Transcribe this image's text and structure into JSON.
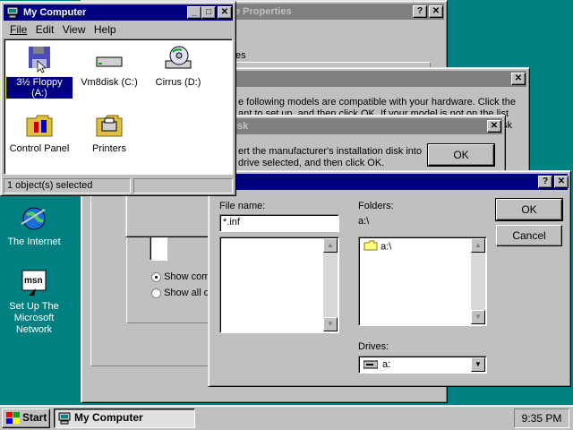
{
  "desktop": {
    "icons": [
      {
        "label": "The Internet",
        "icon": "internet-globe-icon"
      },
      {
        "label": "Set Up The Microsoft Network",
        "icon": "msn-icon"
      }
    ]
  },
  "my_computer": {
    "title": "My Computer",
    "menu": [
      "File",
      "Edit",
      "View",
      "Help"
    ],
    "items": [
      {
        "label": "3½ Floppy (A:)",
        "icon": "floppy-drive-icon",
        "selected": true
      },
      {
        "label": "Vm8disk (C:)",
        "icon": "hard-drive-icon"
      },
      {
        "label": "Cirrus (D:)",
        "icon": "cd-drive-icon"
      },
      {
        "label": "Control Panel",
        "icon": "control-panel-icon"
      },
      {
        "label": "Printers",
        "icon": "printers-folder-icon"
      }
    ],
    "status": "1 object(s) selected"
  },
  "properties": {
    "title_fragment": "e Properties",
    "tab_fragment": "es",
    "radio1": "Show com",
    "radio2": "Show all d"
  },
  "models": {
    "text_line1": "e following models are compatible with your hardware. Click the",
    "text_line2": "ant to set up, and then click OK.  If your model is not on the list",
    "text_line3": "sk"
  },
  "install": {
    "title_fragment": "isk",
    "text_line1": "ert the manufacturer's installation disk into",
    "text_line2": "drive selected, and then click OK.",
    "ok": "OK"
  },
  "open_dialog": {
    "file_name_label": "File name:",
    "file_name_value": "*.inf",
    "folders_label": "Folders:",
    "folders_path": "a:\\",
    "folder_item": "a:\\",
    "drives_label": "Drives:",
    "drive_value": "a:",
    "ok": "OK",
    "cancel": "Cancel"
  },
  "taskbar": {
    "start": "Start",
    "task": "My Computer",
    "clock": "9:35 PM"
  },
  "colors": {
    "desktop": "#008080",
    "title_active": "#000080",
    "title_inactive": "#808080",
    "face": "#c0c0c0"
  }
}
